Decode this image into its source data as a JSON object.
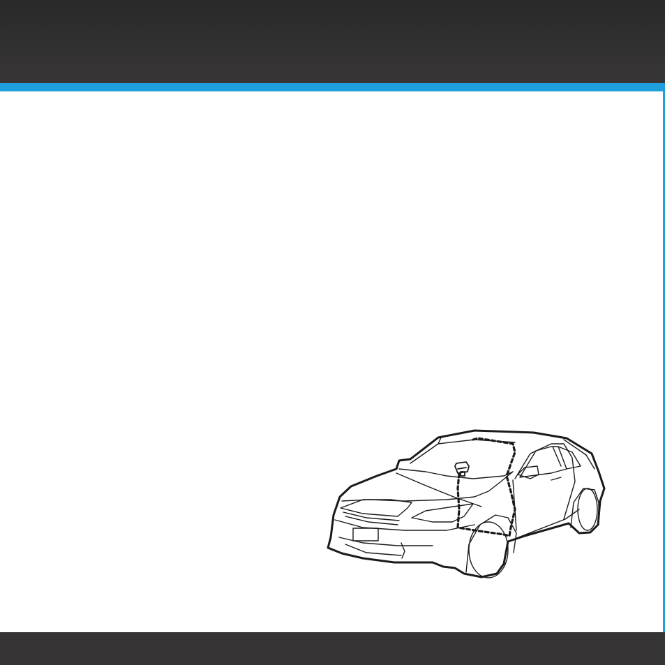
{
  "page": {
    "header_color": "#333132",
    "accent_color": "#1f9fdc",
    "footer_color": "#363435"
  },
  "illustration": {
    "subject": "car-icon",
    "callout": "antenna-cable-routing"
  }
}
